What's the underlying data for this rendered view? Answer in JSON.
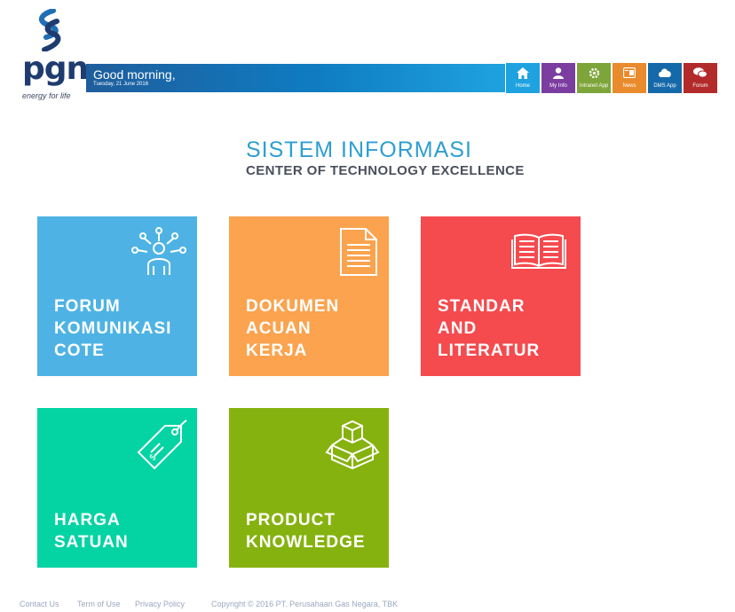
{
  "logo": {
    "word": "pgn",
    "tagline": "energy for life"
  },
  "header": {
    "greeting": "Good morning,",
    "date": "Tuesday, 21 June 2016",
    "nav": [
      {
        "label": "Home",
        "icon": "home-icon",
        "color": "#1fa2e0"
      },
      {
        "label": "My Info",
        "icon": "user-icon",
        "color": "#7b3da0"
      },
      {
        "label": "Intranet App",
        "icon": "gear-icon",
        "color": "#7da53a"
      },
      {
        "label": "News",
        "icon": "news-icon",
        "color": "#e98b2c"
      },
      {
        "label": "DMS App",
        "icon": "cloud-icon",
        "color": "#1569a8"
      },
      {
        "label": "Forum",
        "icon": "chat-icon",
        "color": "#b22a2a"
      }
    ]
  },
  "main": {
    "title": "SISTEM INFORMASI",
    "subtitle": "CENTER OF TECHNOLOGY EXCELLENCE",
    "tiles": [
      {
        "label": "FORUM\nKOMUNIKASI\nCOTE",
        "icon": "network-person-icon",
        "color": "#4eb3e4"
      },
      {
        "label": "DOKUMEN\nACUAN\nKERJA",
        "icon": "document-icon",
        "color": "#fba34e"
      },
      {
        "label": "STANDAR\nAND\nLITERATUR",
        "icon": "open-book-icon",
        "color": "#f54a4e"
      },
      {
        "label": "HARGA\nSATUAN",
        "icon": "price-tag-icon",
        "color": "#04d3a4"
      },
      {
        "label": "PRODUCT\nKNOWLEDGE",
        "icon": "box-icon",
        "color": "#86b20f"
      }
    ]
  },
  "footer": {
    "contact": "Contact Us",
    "terms": "Term of Use",
    "privacy": "Privacy Policy",
    "copyright": "Copyright © 2016 PT. Perusahaan Gas Negara, TBK"
  }
}
